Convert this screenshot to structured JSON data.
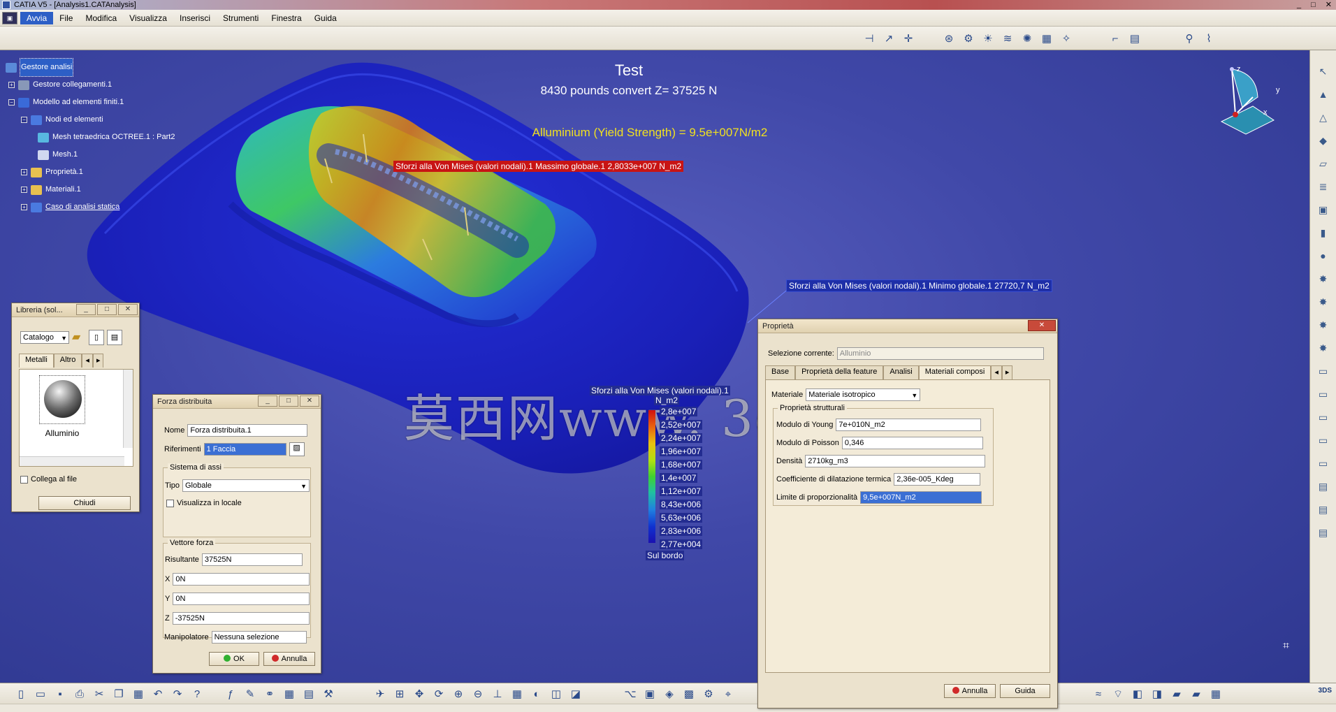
{
  "window": {
    "title": "CATIA V5 - [Analysis1.CATAnalysis]"
  },
  "menu": [
    "Avvia",
    "File",
    "Modifica",
    "Visualizza",
    "Inserisci",
    "Strumenti",
    "Finestra",
    "Guida"
  ],
  "tree": [
    {
      "label": "Gestore analisi",
      "selected": true
    },
    {
      "label": "Gestore collegamenti.1"
    },
    {
      "label": "Modello ad elementi finiti.1"
    },
    {
      "label": "Nodi ed elementi"
    },
    {
      "label": "Mesh tetraedrica OCTREE.1 : Part2"
    },
    {
      "label": "Mesh.1"
    },
    {
      "label": "Proprietà.1"
    },
    {
      "label": "Materiali.1"
    },
    {
      "label": "Caso di analisi statica",
      "underline": true
    }
  ],
  "annotations": {
    "title": "Test",
    "conversion": "8430 pounds convert Z= 37525 N",
    "yield": "Alluminium (Yield Strength) = 9.5e+007N/m2",
    "max_tag": "Sforzi alla Von Mises (valori nodali).1  Massimo globale.1  2,8033e+007 N_m2",
    "min_tag": "Sforzi alla Von Mises (valori nodali).1  Minimo globale.1  27720,7 N_m2"
  },
  "legend": {
    "title": "Sforzi alla Von Mises (valori nodali).1",
    "unit": "N_m2",
    "values": [
      "2,8e+007",
      "2,52e+007",
      "2,24e+007",
      "1,96e+007",
      "1,68e+007",
      "1,4e+007",
      "1,12e+007",
      "8,43e+006",
      "5,63e+006",
      "2,83e+006",
      "2,77e+004"
    ],
    "footer": "Sul bordo"
  },
  "watermark": "莫西网www. 3dmox .com",
  "compass": {
    "x": "x",
    "y": "y",
    "z": "z"
  },
  "library": {
    "title": "Libreria (sol...",
    "catalog": "Catalogo",
    "tabs": [
      "Metalli",
      "Altro"
    ],
    "item": "Alluminio",
    "link_label": "Collega al file",
    "close": "Chiudi"
  },
  "force": {
    "title": "Forza distribuita",
    "name_label": "Nome",
    "name_value": "Forza distribuita.1",
    "ref_label": "Riferimenti",
    "ref_value": "1 Faccia",
    "axis_group": "Sistema di assi",
    "type_label": "Tipo",
    "type_value": "Globale",
    "local_label": "Visualizza in locale",
    "vector_group": "Vettore forza",
    "res_label": "Risultante",
    "res_value": "37525N",
    "x_label": "X",
    "x_value": "0N",
    "y_label": "Y",
    "y_value": "0N",
    "z_label": "Z",
    "z_value": "-37525N",
    "manip_label": "Manipolatore",
    "manip_value": "Nessuna selezione",
    "ok": "OK",
    "cancel": "Annulla"
  },
  "props": {
    "title": "Proprietà",
    "selection_label": "Selezione corrente:",
    "selection_value": "Alluminio",
    "tabs": [
      "Base",
      "Proprietà della feature",
      "Analisi",
      "Materiali composi"
    ],
    "material_label": "Materiale",
    "material_value": "Materiale isotropico",
    "struct_group": "Proprietà strutturali",
    "rows": [
      {
        "label": "Modulo di Young",
        "value": "7e+010N_m2"
      },
      {
        "label": "Modulo di Poisson",
        "value": "0,346"
      },
      {
        "label": "Densità",
        "value": "2710kg_m3"
      },
      {
        "label": "Coefficiente di dilatazione termica",
        "value": "2,36e-005_Kdeg"
      },
      {
        "label": "Limite di proporzionalità",
        "value": "9,5e+007N_m2",
        "selected": true
      }
    ],
    "cancel": "Annulla",
    "help": "Guida"
  },
  "colors": {
    "viewport": "#3a40a0",
    "select": "#2d5fc6",
    "max_tag": "#c81414",
    "min_tag": "#1e2fa8"
  }
}
